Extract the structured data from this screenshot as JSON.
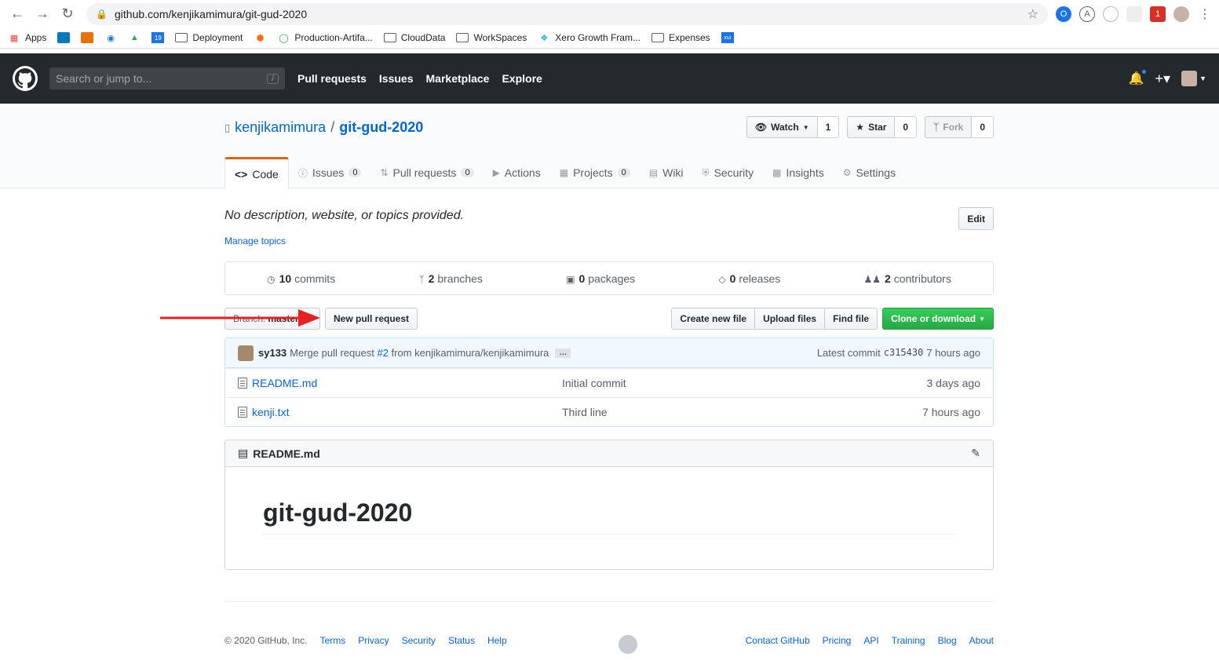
{
  "browser": {
    "url": "github.com/kenjikamimura/git-gud-2020",
    "bookmarks": [
      "Apps",
      "Deployment",
      "Production-Artifa...",
      "CloudData",
      "WorkSpaces",
      "Xero Growth Fram...",
      "Expenses"
    ]
  },
  "header": {
    "search_placeholder": "Search or jump to...",
    "slash": "/",
    "nav": [
      "Pull requests",
      "Issues",
      "Marketplace",
      "Explore"
    ]
  },
  "repo": {
    "owner": "kenjikamimura",
    "sep": "/",
    "name": "git-gud-2020",
    "watch_label": "Watch",
    "watch_count": "1",
    "star_label": "Star",
    "star_count": "0",
    "fork_label": "Fork",
    "fork_count": "0",
    "tabs": [
      {
        "label": "Code",
        "counter": ""
      },
      {
        "label": "Issues",
        "counter": "0"
      },
      {
        "label": "Pull requests",
        "counter": "0"
      },
      {
        "label": "Actions",
        "counter": ""
      },
      {
        "label": "Projects",
        "counter": "0"
      },
      {
        "label": "Wiki",
        "counter": ""
      },
      {
        "label": "Security",
        "counter": ""
      },
      {
        "label": "Insights",
        "counter": ""
      },
      {
        "label": "Settings",
        "counter": ""
      }
    ]
  },
  "main": {
    "description": "No description, website, or topics provided.",
    "edit_label": "Edit",
    "manage_topics": "Manage topics",
    "summary": {
      "commits_num": "10",
      "commits_label": "commits",
      "branches_num": "2",
      "branches_label": "branches",
      "packages_num": "0",
      "packages_label": "packages",
      "releases_num": "0",
      "releases_label": "releases",
      "contributors_num": "2",
      "contributors_label": "contributors"
    },
    "branch_label": "Branch:",
    "branch_value": "master",
    "new_pr_label": "New pull request",
    "create_file_label": "Create new file",
    "upload_label": "Upload files",
    "find_label": "Find file",
    "clone_label": "Clone or download",
    "commit": {
      "user": "sy133",
      "message_prefix": "Merge pull request",
      "pr_link": "#2",
      "message_suffix": "from kenjikamimura/kenjikamimura",
      "ellipsis": "…",
      "latest_label": "Latest commit",
      "sha": "c315430",
      "age": "7 hours ago"
    },
    "files": [
      {
        "name": "README.md",
        "message": "Initial commit",
        "age": "3 days ago"
      },
      {
        "name": "kenji.txt",
        "message": "Third line",
        "age": "7 hours ago"
      }
    ],
    "readme_title": "README.md",
    "readme_h1": "git-gud-2020"
  },
  "footer": {
    "copyright": "© 2020 GitHub, Inc.",
    "left_links": [
      "Terms",
      "Privacy",
      "Security",
      "Status",
      "Help"
    ],
    "right_links": [
      "Contact GitHub",
      "Pricing",
      "API",
      "Training",
      "Blog",
      "About"
    ]
  },
  "colors": {
    "accent": "#0366d6",
    "header_bg": "#24292e",
    "arrow": "#e8201f",
    "clone_green": "#28a745"
  }
}
